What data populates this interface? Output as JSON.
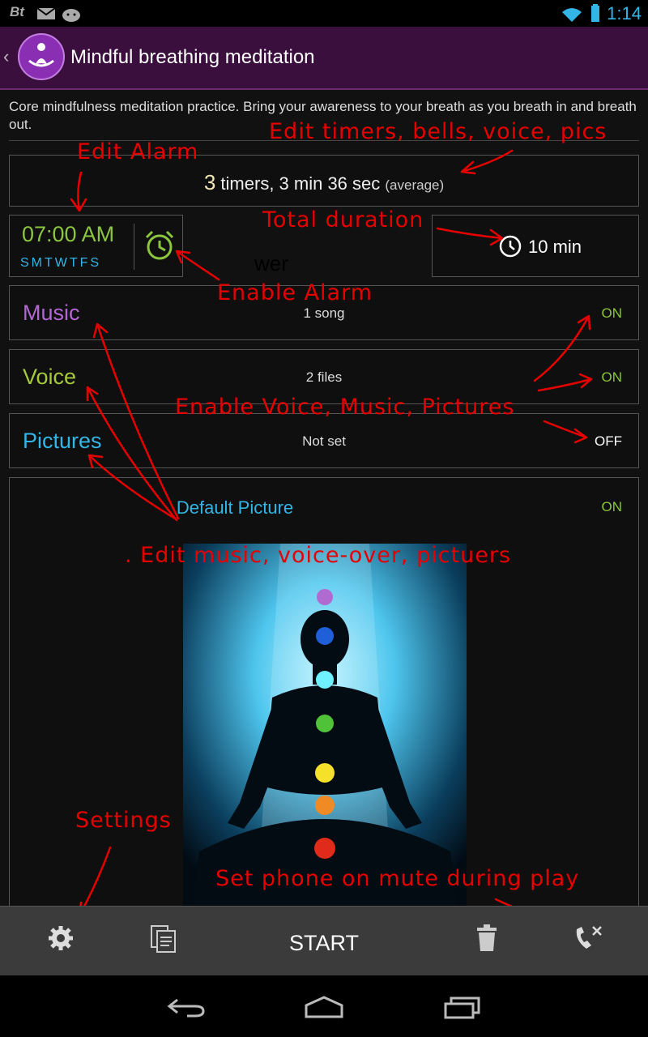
{
  "status_bar": {
    "left_icons": "Bt",
    "time": "1:14"
  },
  "action_bar": {
    "title": "Mindful breathing meditation",
    "back_icon": "chevron-left-icon",
    "logo_icon": "meditation-icon"
  },
  "description": "Core mindfulness meditation practice. Bring your awareness to your breath as you breath in and breath out.",
  "timers": {
    "count": "3",
    "text": " timers, 3 min 36 sec",
    "note": "(average)"
  },
  "alarm": {
    "time": "07:00 AM",
    "days": "SMTWTFS"
  },
  "duration": {
    "value": "10 min"
  },
  "stray_text": "wer",
  "music": {
    "label": "Music",
    "detail": "1 song",
    "toggle": "ON"
  },
  "voice": {
    "label": "Voice",
    "detail": "2  files",
    "toggle": "ON"
  },
  "pictures": {
    "label": "Pictures",
    "detail": "Not set",
    "toggle": "OFF"
  },
  "default_picture": {
    "title": "Default Picture",
    "toggle": "ON"
  },
  "toolbar": {
    "start_label": "START"
  },
  "annotations": {
    "edit_timers": "Edit timers, bells, voice, pics",
    "edit_alarm": "Edit Alarm",
    "total_duration": "Total duration",
    "enable_alarm": "Enable Alarm",
    "enable_vmp": "Enable Voice, Music, Pictures",
    "edit_mvp": ".  Edit music, voice-over, pictuers",
    "settings": "Settings",
    "mute": "Set phone on mute during play"
  },
  "colors": {
    "accent_green": "#8cc63f",
    "accent_blue": "#33b5e5",
    "music_purple": "#b366d6",
    "annotation_red": "#e60000",
    "action_bar": "#3a0f3e"
  }
}
